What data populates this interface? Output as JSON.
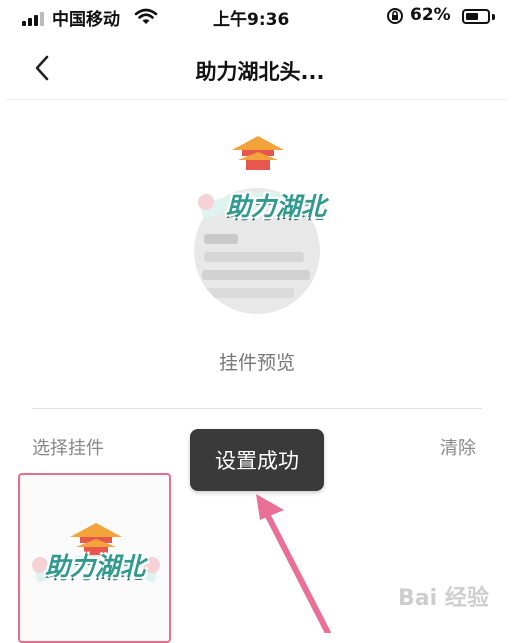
{
  "status_bar": {
    "carrier": "中国移动",
    "time": "上午9:36",
    "battery_percent": "62%",
    "battery_level": 0.62
  },
  "nav": {
    "title": "助力湖北头..."
  },
  "preview": {
    "pendant_text": "助力湖北",
    "label": "挂件预览"
  },
  "section": {
    "select_label": "选择挂件",
    "clear_label": "清除"
  },
  "toast": {
    "message": "设置成功"
  },
  "options": [
    {
      "text": "助力湖北",
      "selected": true
    }
  ],
  "watermark": "Bai 经验",
  "colors": {
    "accent_pink": "#e86e8a",
    "pendant_teal": "#2f9a8d",
    "toast_bg": "#3a3a3a"
  }
}
